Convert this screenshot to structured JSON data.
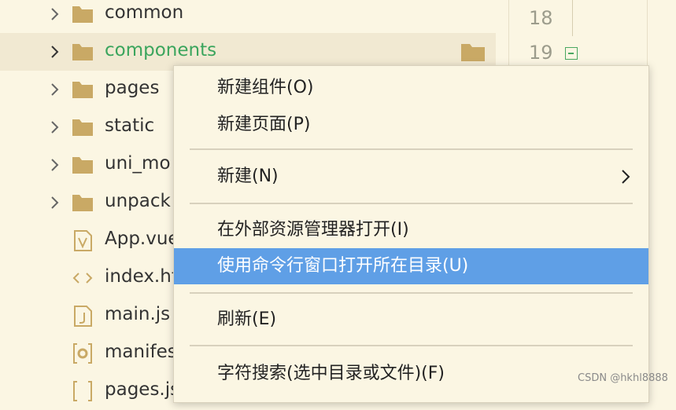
{
  "tree": {
    "items": [
      {
        "label": "common",
        "kind": "folder",
        "icon": "folder-icon"
      },
      {
        "label": "components",
        "kind": "folder",
        "icon": "folder-icon",
        "selected": true
      },
      {
        "label": "pages",
        "kind": "folder",
        "icon": "folder-icon"
      },
      {
        "label": "static",
        "kind": "folder",
        "icon": "folder-icon"
      },
      {
        "label": "uni_mo",
        "kind": "folder",
        "icon": "folder-icon"
      },
      {
        "label": "unpack",
        "kind": "folder",
        "icon": "folder-icon"
      },
      {
        "label": "App.vue",
        "kind": "file",
        "icon": "vue-file-icon"
      },
      {
        "label": "index.ht",
        "kind": "file",
        "icon": "html-file-icon"
      },
      {
        "label": "main.js",
        "kind": "file",
        "icon": "js-file-icon"
      },
      {
        "label": "manifes",
        "kind": "file",
        "icon": "manifest-file-icon"
      },
      {
        "label": "pages.js",
        "kind": "file",
        "icon": "json-file-icon"
      }
    ]
  },
  "editor": {
    "line_numbers": [
      "18",
      "19"
    ]
  },
  "context_menu": {
    "items": [
      {
        "label": "新建组件(O)"
      },
      {
        "label": "新建页面(P)"
      },
      {
        "label": "新建(N)",
        "has_submenu": true
      },
      {
        "label": "在外部资源管理器打开(I)"
      },
      {
        "label": "使用命令行窗口打开所在目录(U)",
        "highlighted": true
      },
      {
        "label": "刷新(E)"
      },
      {
        "label": "字符搜索(选中目录或文件)(F)"
      }
    ]
  },
  "colors": {
    "background": "#fbf6e3",
    "selected_row": "#f1e9d2",
    "selected_text": "#3ba55d",
    "highlight": "#5f9fe6",
    "folder": "#c9a965"
  },
  "watermark": "CSDN @hkhl8888"
}
